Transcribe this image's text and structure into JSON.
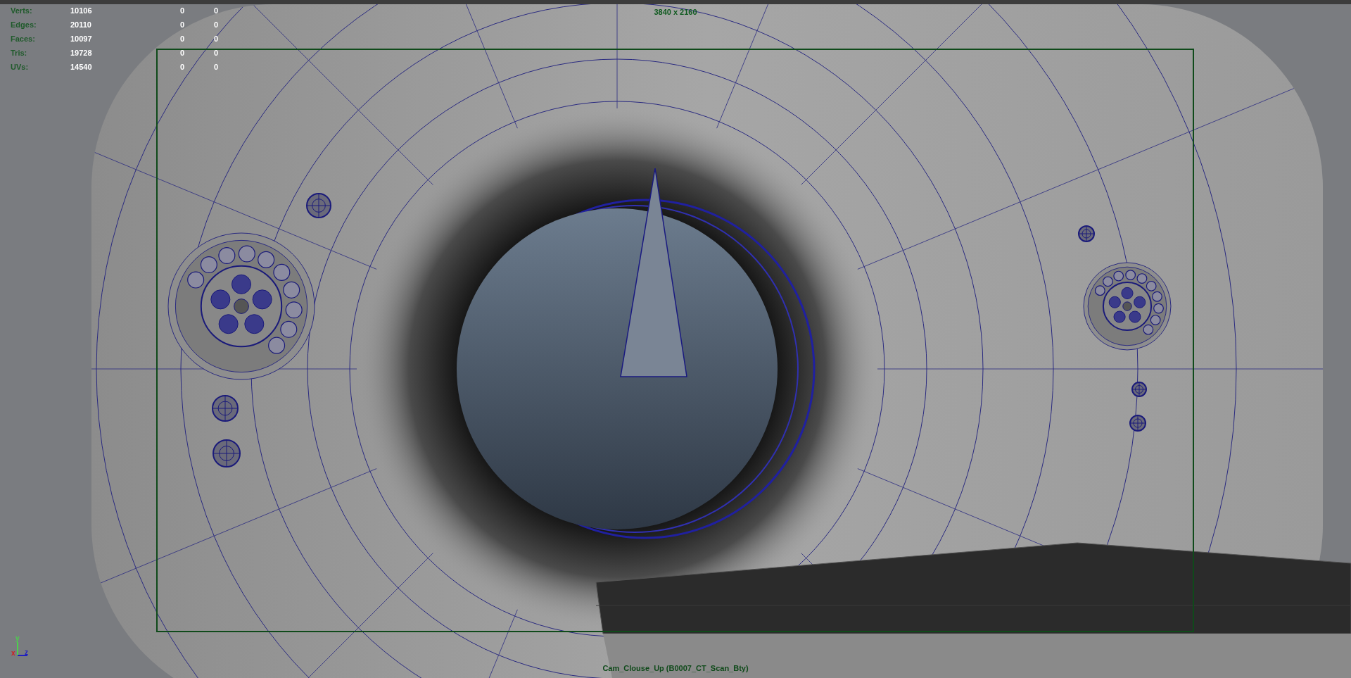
{
  "stats": [
    {
      "label": "Verts:",
      "value": "10106",
      "column_3": "0",
      "column_4": "0"
    },
    {
      "label": "Edges:",
      "value": "20110",
      "column_3": "0",
      "column_4": "0"
    },
    {
      "label": "Faces:",
      "value": "10097",
      "column_3": "0",
      "column_4": "0"
    },
    {
      "label": "Tris:",
      "value": "19728",
      "column_3": "0",
      "column_4": "0"
    },
    {
      "label": "UVs:",
      "value": "14540",
      "column_3": "0",
      "column_4": "0"
    }
  ],
  "resolution": "3840 x 2160",
  "camera_label": "Cam_Clouse_Up (B0007_CT_Scan_Bty)",
  "axis": {
    "y": "y",
    "x": "x",
    "z": "z"
  }
}
